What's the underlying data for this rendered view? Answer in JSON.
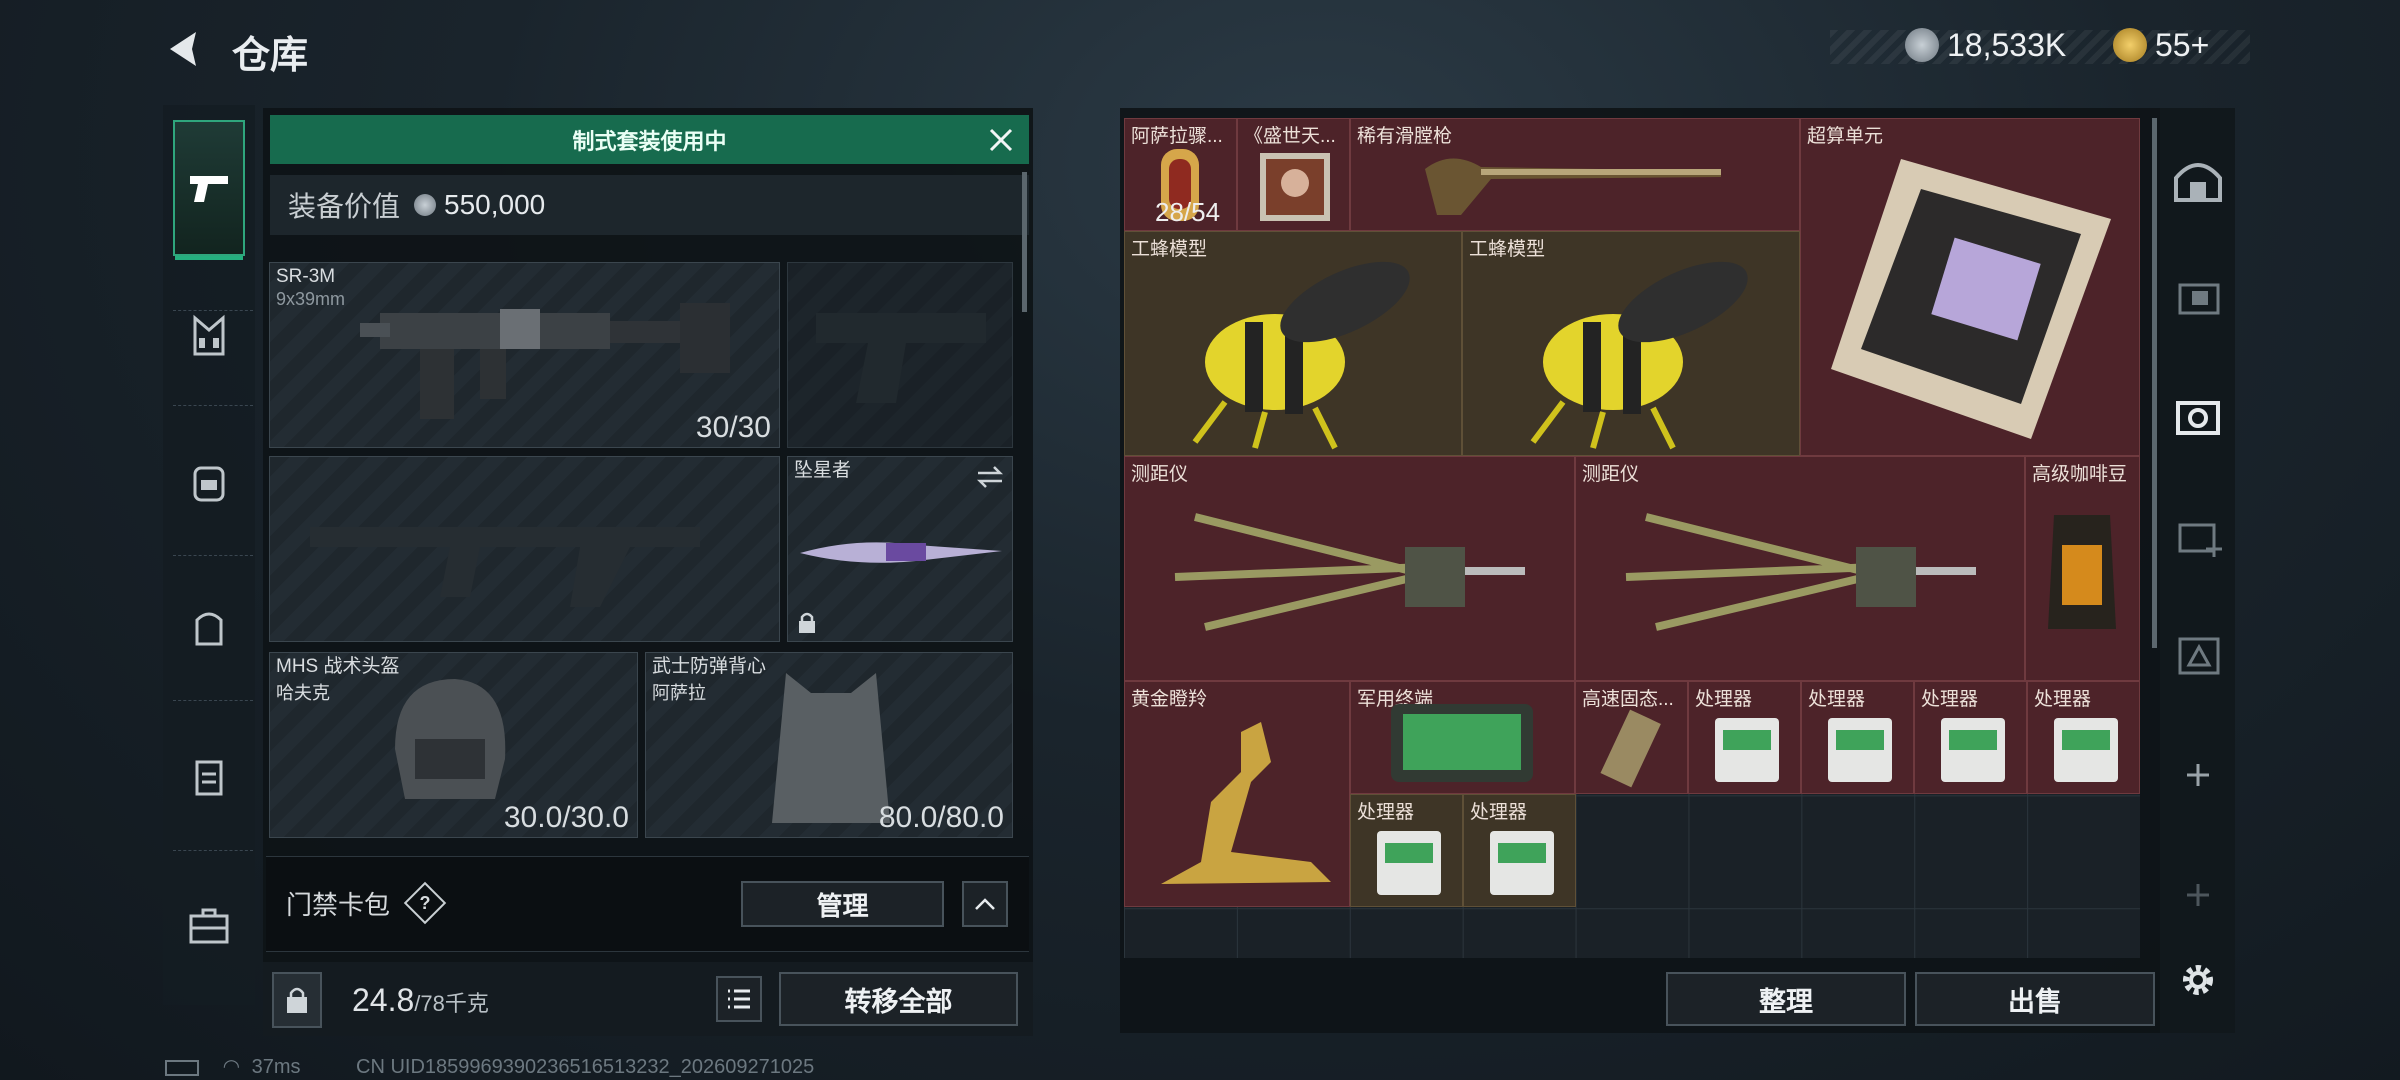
{
  "header": {
    "title": "仓库"
  },
  "currency": [
    {
      "icon": "silver-coin-icon",
      "value": "18,533K"
    },
    {
      "icon": "gold-coin-icon",
      "value": "55+"
    }
  ],
  "left": {
    "banner": "制式套装使用中",
    "value_label": "装备价值",
    "value": "550,000",
    "slots": {
      "primary": {
        "name": "SR-3M",
        "ammo": "9x39mm",
        "count": "30/30"
      },
      "melee": {
        "name": "坠星者"
      },
      "helmet": {
        "name": "MHS 战术头盔",
        "sub": "哈夫克",
        "count": "30.0/30.0"
      },
      "armor": {
        "name": "武士防弹背心",
        "sub": "阿萨拉",
        "count": "80.0/80.0"
      }
    },
    "keycase": {
      "label": "门禁卡包",
      "help": "?",
      "manage": "管理"
    },
    "weight": {
      "value": "24.8",
      "unit": "/78千克"
    },
    "transfer_all": "转移全部"
  },
  "stash": {
    "items": [
      {
        "name": "阿萨拉骤...",
        "count": "28/54"
      },
      {
        "name": "《盛世天..."
      },
      {
        "name": "稀有滑膛枪"
      },
      {
        "name": "超算单元"
      },
      {
        "name": "工蜂模型"
      },
      {
        "name": "工蜂模型"
      },
      {
        "name": "测距仪"
      },
      {
        "name": "测距仪"
      },
      {
        "name": "高级咖啡豆"
      },
      {
        "name": "黄金瞪羚"
      },
      {
        "name": "军用终端"
      },
      {
        "name": "高速固态..."
      },
      {
        "name": "处理器"
      },
      {
        "name": "处理器"
      },
      {
        "name": "处理器"
      },
      {
        "name": "处理器"
      },
      {
        "name": "处理器"
      },
      {
        "name": "处理器"
      }
    ],
    "sort": "整理",
    "sell": "出售"
  },
  "status": {
    "ping": "37ms",
    "uid": "CN UID1859969390236516513232_202609271025"
  },
  "colors": {
    "accent": "#176b4e",
    "rare": "#4d2329",
    "gold": "#3e3526"
  }
}
